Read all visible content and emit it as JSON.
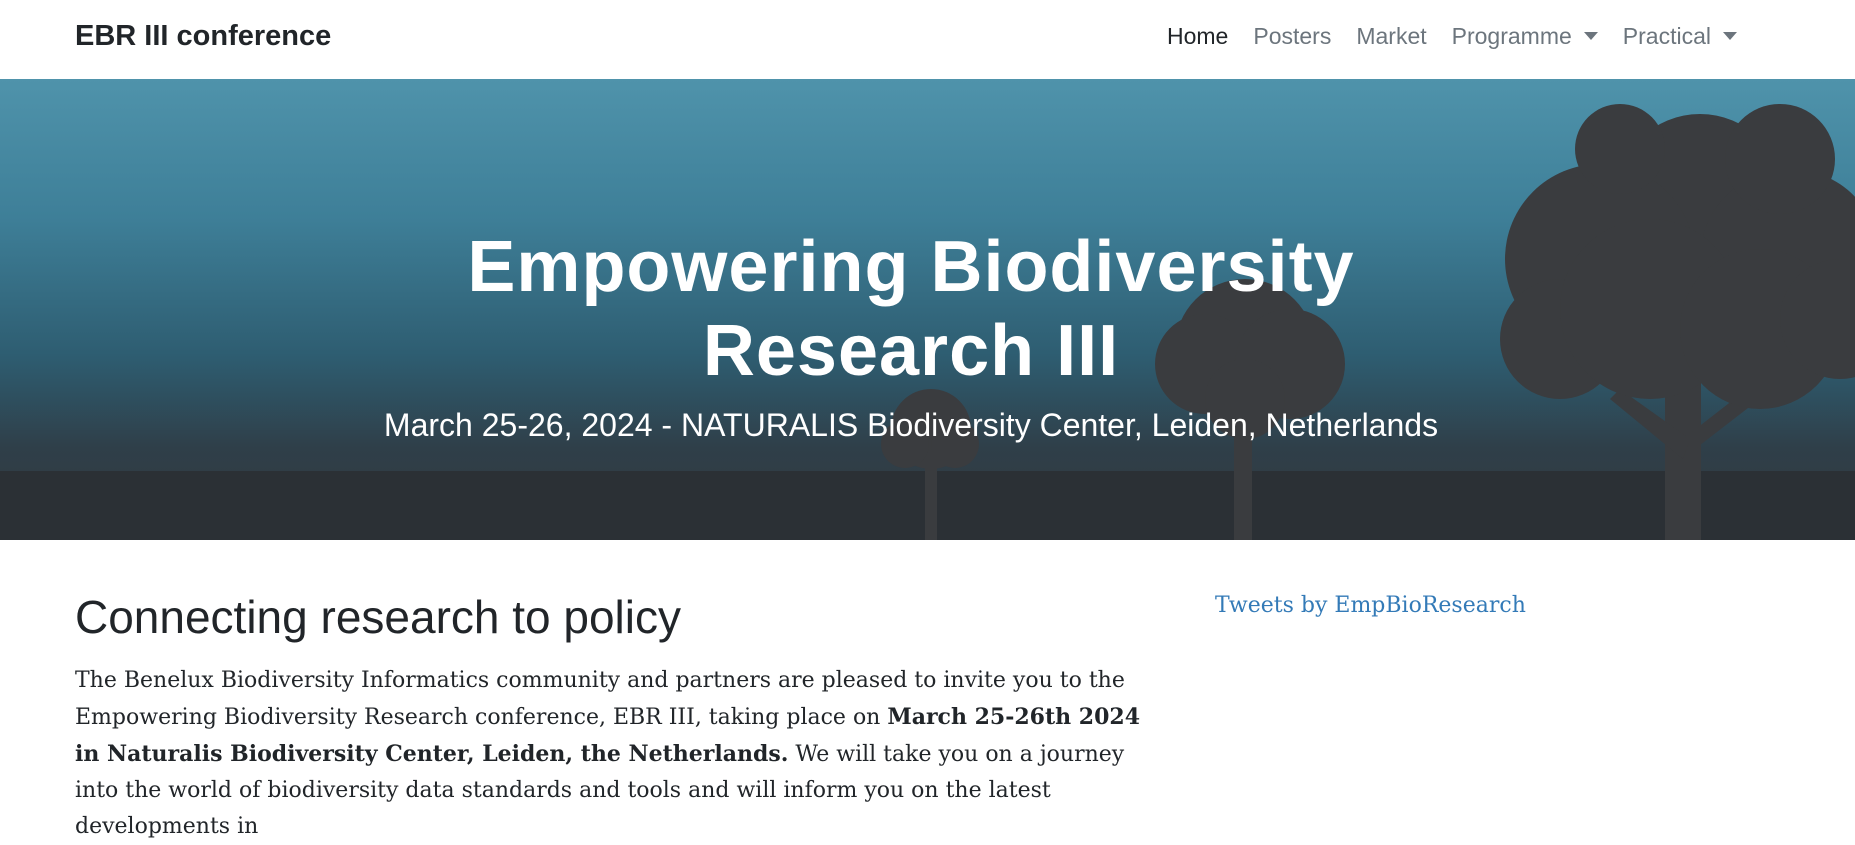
{
  "navbar": {
    "brand": "EBR III conference",
    "items": [
      {
        "label": "Home",
        "active": true,
        "dropdown": false
      },
      {
        "label": "Posters",
        "active": false,
        "dropdown": false
      },
      {
        "label": "Market",
        "active": false,
        "dropdown": false
      },
      {
        "label": "Programme",
        "active": false,
        "dropdown": true
      },
      {
        "label": "Practical",
        "active": false,
        "dropdown": true
      }
    ]
  },
  "hero": {
    "title_line1": "Empowering Biodiversity",
    "title_line2": "Research III",
    "subtitle": "March 25-26, 2024 - NATURALIS Biodiversity Center, Leiden, Netherlands"
  },
  "main": {
    "heading": "Connecting research to policy",
    "intro_part1": "The Benelux Biodiversity Informatics community and partners are pleased to invite you to the Empowering Biodiversity Research conference, EBR III, taking place on ",
    "intro_bold": "March 25-26th 2024 in Naturalis Biodiversity Center, Leiden, the Netherlands.",
    "intro_part2": " We will take you on a journey into the world of biodiversity data standards and tools and will inform you on the latest developments in"
  },
  "sidebar": {
    "tweets_link": "Tweets by EmpBioResearch"
  },
  "colors": {
    "link": "#337ab7",
    "hero_sky_top": "#4f93ab",
    "hero_ground": "#2b3035",
    "tree_silhouette": "#3a3c3f"
  }
}
